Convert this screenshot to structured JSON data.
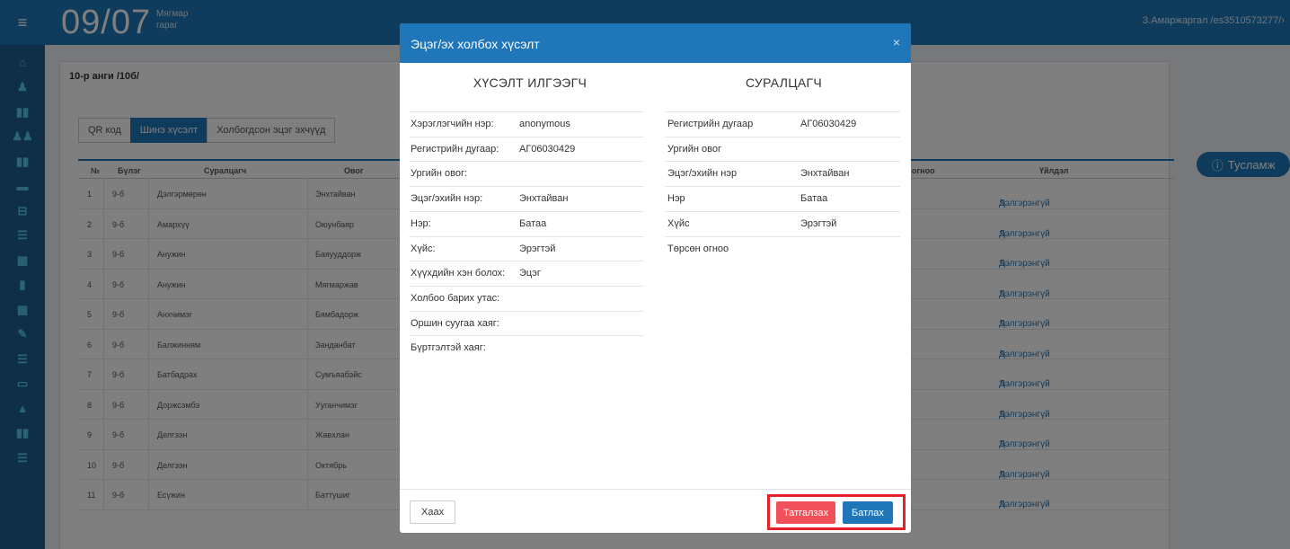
{
  "topbar": {
    "day_month": "09/07",
    "weekday_line1": "Мягмар",
    "weekday_line2": "гараг",
    "user": "З.Амаржаргал /es3510573277/›"
  },
  "sidebar": {
    "icons": [
      "home-icon",
      "users-icon",
      "book-icon",
      "group-icon",
      "book-icon",
      "folder-icon",
      "print-icon",
      "list-icon",
      "calendar-icon",
      "trash-icon",
      "calendar-icon",
      "edit-icon",
      "list-icon",
      "chat-icon",
      "graduation-icon",
      "book-icon",
      "list-icon"
    ]
  },
  "page": {
    "breadcrumb": "10-р анги /10б/",
    "tabs": [
      {
        "label": "QR код",
        "active": false
      },
      {
        "label": "Шинэ хүсэлт",
        "active": true
      },
      {
        "label": "Холбогдсон эцэг эхчүүд",
        "active": false
      }
    ],
    "table": {
      "headers": [
        "№",
        "Бүлэг",
        "Суралцагч",
        "Овог",
        "н огноо",
        "Үйлдэл"
      ],
      "rows": [
        {
          "no": "1",
          "group": "9-б",
          "student": "Дэлгэрмөрөн",
          "surname": "Энхтайван",
          "action": "Дэлгэрэнгүй"
        },
        {
          "no": "2",
          "group": "9-б",
          "student": "Амархүү",
          "surname": "Оюунбаяр",
          "action": "Дэлгэрэнгүй"
        },
        {
          "no": "3",
          "group": "9-б",
          "student": "Анужин",
          "surname": "Баяууддорж",
          "action": "Дэлгэрэнгүй"
        },
        {
          "no": "4",
          "group": "9-б",
          "student": "Анужин",
          "surname": "Мягмаржав",
          "action": "Дэлгэрэнгүй"
        },
        {
          "no": "5",
          "group": "9-б",
          "student": "Анхчимэг",
          "surname": "Бямбадорж",
          "action": "Дэлгэрэнгүй"
        },
        {
          "no": "6",
          "group": "9-б",
          "student": "Балжинням",
          "surname": "Занданбат",
          "action": "Дэлгэрэнгүй"
        },
        {
          "no": "7",
          "group": "9-б",
          "student": "Батбадрах",
          "surname": "Сумъяабэйс",
          "action": "Дэлгэрэнгүй"
        },
        {
          "no": "8",
          "group": "9-б",
          "student": "Доржсэмбэ",
          "surname": "Ууганчимэг",
          "action": "Дэлгэрэнгүй"
        },
        {
          "no": "9",
          "group": "9-б",
          "student": "Делгээн",
          "surname": "Жавхлан",
          "action": "Дэлгэрэнгүй"
        },
        {
          "no": "10",
          "group": "9-б",
          "student": "Делгээн",
          "surname": "Октябрь",
          "action": "Дэлгэрэнгүй"
        },
        {
          "no": "11",
          "group": "9-б",
          "student": "Есүжин",
          "surname": "Баттушиг",
          "action": "Дэлгэрэнгүй"
        }
      ]
    },
    "help_label": "Тусламж"
  },
  "modal": {
    "title": "Эцэг/эх холбох хүсэлт",
    "close_symbol": "×",
    "requester": {
      "heading": "ХҮСЭЛТ ИЛГЭЭГЧ",
      "fields": [
        {
          "label": "Хэрэглэгчийн нэр:",
          "value": "anonymous"
        },
        {
          "label": "Регистрийн дугаар:",
          "value": "АГ06030429"
        },
        {
          "label": "Ургийн овог:",
          "value": ""
        },
        {
          "label": "Эцэг/эхийн нэр:",
          "value": "Энхтайван"
        },
        {
          "label": "Нэр:",
          "value": "Батаа"
        },
        {
          "label": "Хүйс:",
          "value": "Эрэгтэй"
        },
        {
          "label": "Хүүхдийн хэн болох:",
          "value": "Эцэг"
        },
        {
          "label": "Холбоо барих утас:",
          "value": ""
        },
        {
          "label": "Оршин суугаа хаяг:",
          "value": ""
        },
        {
          "label": "Бүртгэлтэй хаяг:",
          "value": ""
        }
      ]
    },
    "student": {
      "heading": "СУРАЛЦАГЧ",
      "fields": [
        {
          "label": "Регистрийн дугаар",
          "value": "АГ06030429"
        },
        {
          "label": "Ургийн овог",
          "value": ""
        },
        {
          "label": "Эцэг/эхийн нэр",
          "value": "Энхтайван"
        },
        {
          "label": "Нэр",
          "value": "Батаа"
        },
        {
          "label": "Хүйс",
          "value": "Эрэгтэй"
        },
        {
          "label": "Төрсөн огноо",
          "value": ""
        }
      ]
    },
    "footer": {
      "close_label": "Хаах",
      "reject_label": "Татгалзах",
      "approve_label": "Батлах"
    }
  }
}
